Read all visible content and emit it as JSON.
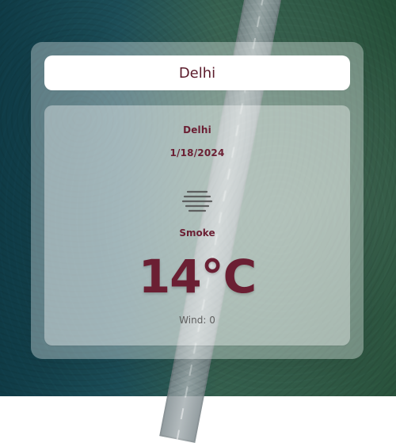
{
  "search": {
    "value": "Delhi"
  },
  "weather": {
    "city": "Delhi",
    "date": "1/18/2024",
    "condition": "Smoke",
    "temperature": "14°C",
    "wind": "Wind: 0"
  },
  "icons": {
    "weather_condition_icon": "smoke-icon"
  },
  "colors": {
    "accent_text": "#6b1f33",
    "card_overlay": "rgba(255,255,255,0.33)",
    "panel_overlay": "rgba(255,255,255,0.38)"
  }
}
